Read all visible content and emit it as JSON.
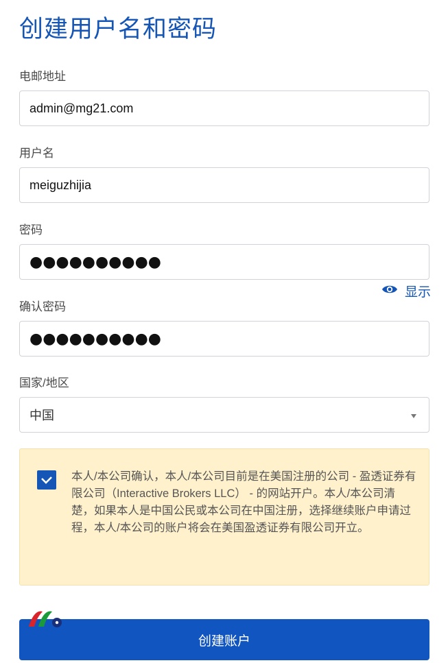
{
  "page": {
    "title": "创建用户名和密码"
  },
  "form": {
    "email": {
      "label": "电邮地址",
      "value": "admin@mg21.com"
    },
    "username": {
      "label": "用户名",
      "value": "meiguzhijia"
    },
    "password": {
      "label": "密码",
      "masked_value": "●●●●●●●●●●",
      "show_label": "显示"
    },
    "confirm_password": {
      "label": "确认密码",
      "masked_value": "●●●●●●●●●●"
    },
    "country": {
      "label": "国家/地区",
      "selected": "中国"
    }
  },
  "notice": {
    "checked": true,
    "text": "本人/本公司确认，本人/本公司目前是在美国注册的公司 - 盈透证券有限公司（Interactive Brokers LLC） - 的网站开户。本人/本公司清楚，如果本人是中国公民或本公司在中国注册，选择继续账户申请过程，本人/本公司的账户将会在美国盈透证券有限公司开立。"
  },
  "submit": {
    "label": "创建账户"
  },
  "colors": {
    "accent": "#1455b5",
    "notice_bg": "#fff1cc",
    "button_bg": "#1155c0"
  }
}
